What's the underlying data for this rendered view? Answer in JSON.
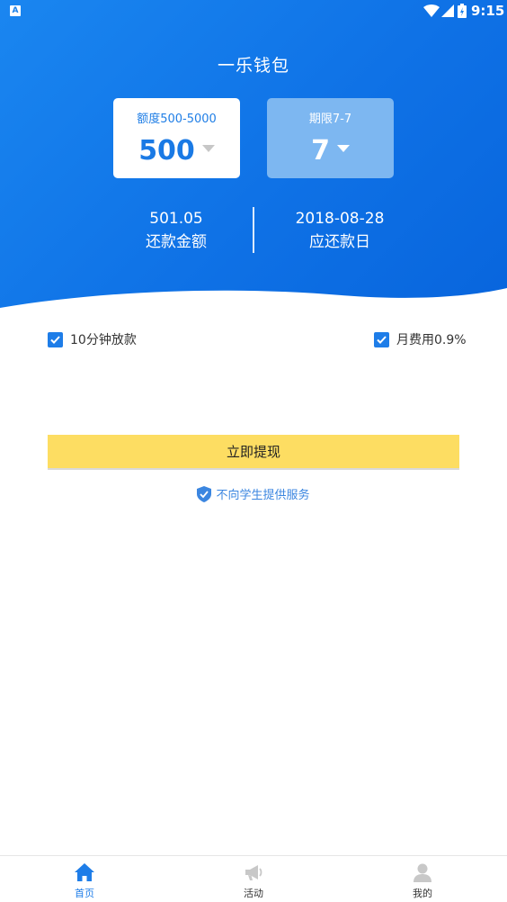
{
  "status_bar": {
    "notification_icon": "A",
    "time": "9:15"
  },
  "header": {
    "title": "一乐钱包"
  },
  "amount_card": {
    "label": "额度500-5000",
    "value": "500"
  },
  "term_card": {
    "label": "期限7-7",
    "value": "7"
  },
  "repayment": {
    "amount_value": "501.05",
    "amount_label": "还款金额",
    "date_value": "2018-08-28",
    "date_label": "应还款日"
  },
  "features": {
    "left": "10分钟放款",
    "right": "月费用0.9%"
  },
  "actions": {
    "withdraw_label": "立即提现"
  },
  "notice": {
    "text": "不向学生提供服务"
  },
  "tabbar": {
    "home": "首页",
    "activity": "活动",
    "mine": "我的"
  },
  "colors": {
    "primary": "#1e7de8",
    "button": "#fddd62",
    "term_card": "#7db7f1"
  }
}
